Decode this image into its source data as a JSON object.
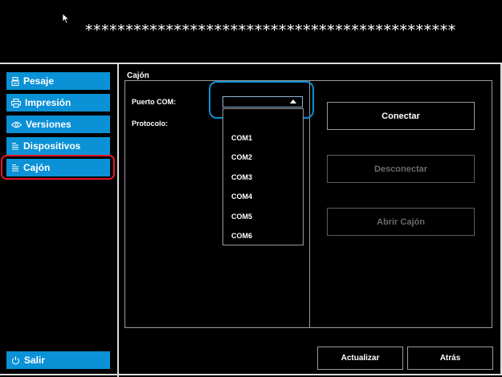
{
  "header": {
    "masked_text": "**********************************************"
  },
  "sidebar": {
    "items": [
      {
        "label": "Pesaje",
        "icon": "scale-icon"
      },
      {
        "label": "Impresión",
        "icon": "printer-icon"
      },
      {
        "label": "Versiones",
        "icon": "eye-icon"
      },
      {
        "label": "Dispositivos",
        "icon": "list-icon"
      },
      {
        "label": "Cajón",
        "icon": "list-icon",
        "selected": true
      }
    ],
    "exit_label": "Salir"
  },
  "main": {
    "section_title": "Cajón",
    "port_label": "Puerto COM:",
    "protocol_label": "Protocolo:",
    "port_value": "",
    "port_options": [
      "COM1",
      "COM2",
      "COM3",
      "COM4",
      "COM5",
      "COM6"
    ],
    "connect_label": "Conectar",
    "disconnect_label": "Desconectar",
    "open_drawer_label": "Abrir Cajón",
    "refresh_label": "Actualizar",
    "back_label": "Atrás"
  },
  "colors": {
    "accent": "#0a91d6",
    "selection_ring": "#e2162a",
    "background": "#000000"
  }
}
